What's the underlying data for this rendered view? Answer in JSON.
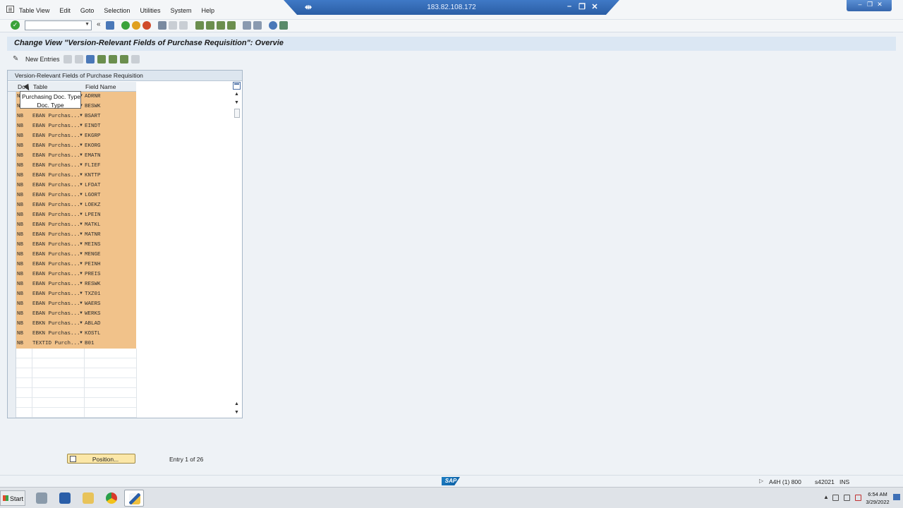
{
  "menubar": {
    "items": [
      "Table View",
      "Edit",
      "Goto",
      "Selection",
      "Utilities",
      "System",
      "Help"
    ]
  },
  "remote": {
    "ip": "183.82.108.172"
  },
  "page": {
    "title": "Change View \"Version-Relevant Fields of Purchase Requisition\": Overvie"
  },
  "app_toolbar": {
    "new_entries": "New Entries"
  },
  "table": {
    "title": "Version-Relevant Fields of Purchase Requisition",
    "col_doc": "Doc",
    "col_table": "Table",
    "col_field": "Field Name",
    "rows": [
      {
        "doc": "NB",
        "table": "EBAN Purchas...",
        "field": "ADRNR"
      },
      {
        "doc": "NB",
        "table": "EBAN Purchas...",
        "field": "BESWK"
      },
      {
        "doc": "NB",
        "table": "EBAN Purchas...",
        "field": "BSART"
      },
      {
        "doc": "NB",
        "table": "EBAN Purchas...",
        "field": "EINDT"
      },
      {
        "doc": "NB",
        "table": "EBAN Purchas...",
        "field": "EKGRP"
      },
      {
        "doc": "NB",
        "table": "EBAN Purchas...",
        "field": "EKORG"
      },
      {
        "doc": "NB",
        "table": "EBAN Purchas...",
        "field": "EMATN"
      },
      {
        "doc": "NB",
        "table": "EBAN Purchas...",
        "field": "FLIEF"
      },
      {
        "doc": "NB",
        "table": "EBAN Purchas...",
        "field": "KNTTP"
      },
      {
        "doc": "NB",
        "table": "EBAN Purchas...",
        "field": "LFDAT"
      },
      {
        "doc": "NB",
        "table": "EBAN Purchas...",
        "field": "LGORT"
      },
      {
        "doc": "NB",
        "table": "EBAN Purchas...",
        "field": "LOEKZ"
      },
      {
        "doc": "NB",
        "table": "EBAN Purchas...",
        "field": "LPEIN"
      },
      {
        "doc": "NB",
        "table": "EBAN Purchas...",
        "field": "MATKL"
      },
      {
        "doc": "NB",
        "table": "EBAN Purchas...",
        "field": "MATNR"
      },
      {
        "doc": "NB",
        "table": "EBAN Purchas...",
        "field": "MEINS"
      },
      {
        "doc": "NB",
        "table": "EBAN Purchas...",
        "field": "MENGE"
      },
      {
        "doc": "NB",
        "table": "EBAN Purchas...",
        "field": "PEINH"
      },
      {
        "doc": "NB",
        "table": "EBAN Purchas...",
        "field": "PREIS"
      },
      {
        "doc": "NB",
        "table": "EBAN Purchas...",
        "field": "RESWK"
      },
      {
        "doc": "NB",
        "table": "EBAN Purchas...",
        "field": "TXZ01"
      },
      {
        "doc": "NB",
        "table": "EBAN Purchas...",
        "field": "WAERS"
      },
      {
        "doc": "NB",
        "table": "EBAN Purchas...",
        "field": "WERKS"
      },
      {
        "doc": "NB",
        "table": "EBKN Purchas...",
        "field": "ABLAD"
      },
      {
        "doc": "NB",
        "table": "EBKN Purchas...",
        "field": "KOSTL"
      },
      {
        "doc": "NB",
        "table": "TEXTID Purch...",
        "field": "B01"
      }
    ]
  },
  "tooltip": {
    "line1": "Purchasing Doc. Type",
    "line2": "Doc. Type"
  },
  "footer": {
    "position_label": "Position...",
    "entry_info": "Entry 1 of 26"
  },
  "status": {
    "logo": "SAP",
    "system": "A4H (1) 800",
    "host": "s42021",
    "mode": "INS"
  },
  "taskbar": {
    "start": "Start",
    "time": "6:54 AM",
    "date": "3/29/2022"
  },
  "colors": {
    "highlight": "#f1c28a",
    "title_bg": "#dbe7f3",
    "accent": "#2b5ea5"
  }
}
